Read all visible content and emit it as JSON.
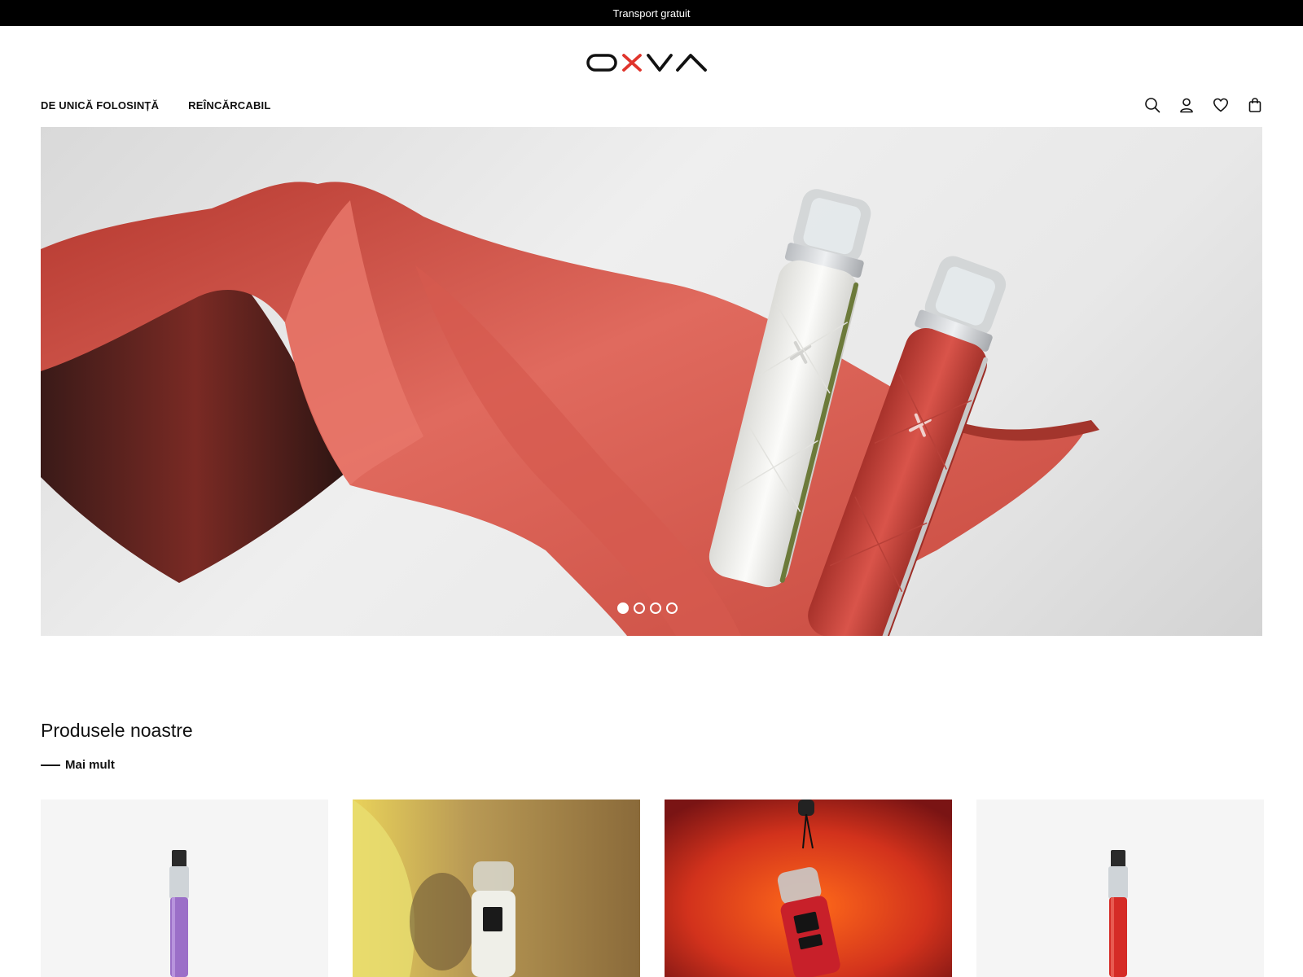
{
  "announcement": {
    "text": "Transport gratuit"
  },
  "brand": {
    "name": "OXVA",
    "colors": {
      "dark": "#111111",
      "accent": "#e0342c"
    }
  },
  "nav": {
    "items": [
      {
        "label": "DE UNICĂ FOLOSINȚĂ"
      },
      {
        "label": "REÎNCĂRCABIL"
      }
    ]
  },
  "toolbar": {
    "icons": [
      "search-icon",
      "account-icon",
      "wishlist-heart-icon",
      "cart-bag-icon"
    ]
  },
  "hero": {
    "slides_total": 4,
    "active_slide": 1,
    "colors": {
      "fabric": "#d9544a",
      "device_white": "#f2f2f0",
      "device_red": "#c9463d"
    }
  },
  "products_section": {
    "title": "Produsele noastre",
    "more_label": "Mai mult",
    "cards": [
      {
        "name": "product-card-1",
        "bg": "#f5f5f5",
        "device_color": "#9b6fc8"
      },
      {
        "name": "product-card-2",
        "bg": "#c8a24a",
        "device_color": "#e9e9e9"
      },
      {
        "name": "product-card-3",
        "bg": "#d63a1f",
        "device_color": "#c8202a"
      },
      {
        "name": "product-card-4",
        "bg": "#f5f5f5",
        "device_color": "#d52b26"
      }
    ]
  }
}
